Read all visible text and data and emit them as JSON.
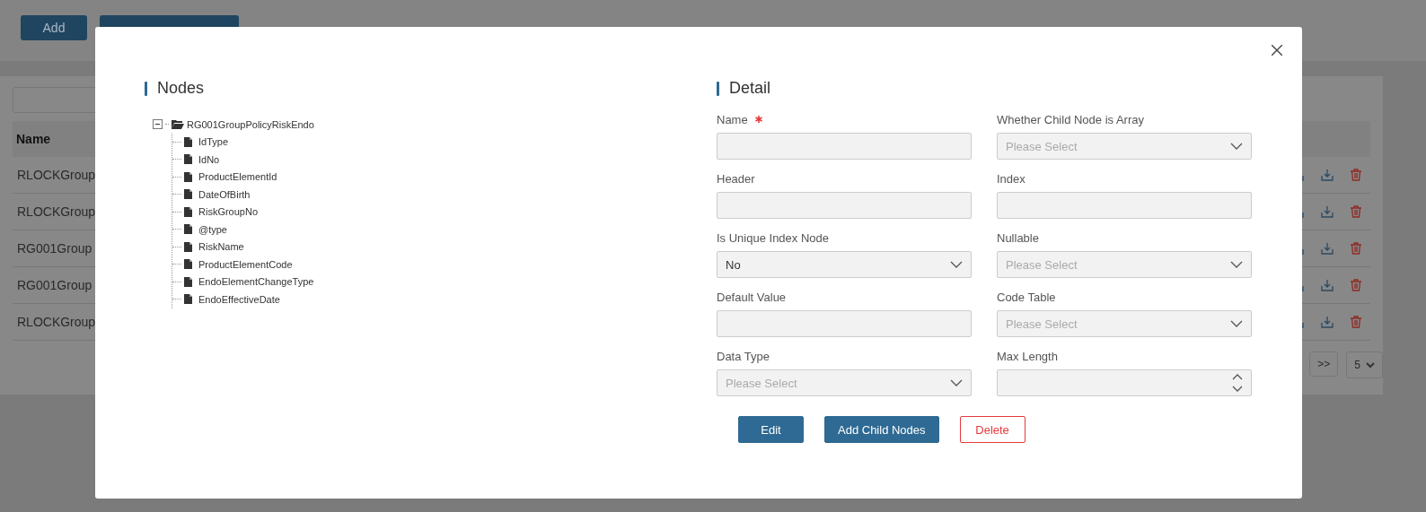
{
  "page": {
    "buttons": [
      {
        "label": "Add"
      }
    ],
    "table": {
      "columns": [
        "Name"
      ],
      "rows": [
        {
          "name": "RLOCKGroup"
        },
        {
          "name": "RLOCKGroup"
        },
        {
          "name": "RG001Group"
        },
        {
          "name": "RG001Group"
        },
        {
          "name": "RLOCKGroup"
        }
      ]
    },
    "pagination": {
      "next": ">>",
      "page_size": "5"
    }
  },
  "modal": {
    "nodes_title": "Nodes",
    "tree": {
      "label": "RG001GroupPolicyRiskEndo",
      "expanded": true,
      "children": [
        {
          "label": "IdType"
        },
        {
          "label": "IdNo"
        },
        {
          "label": "ProductElementId"
        },
        {
          "label": "DateOfBirth"
        },
        {
          "label": "RiskGroupNo"
        },
        {
          "label": "@type"
        },
        {
          "label": "RiskName"
        },
        {
          "label": "ProductElementCode"
        },
        {
          "label": "EndoElementChangeType"
        },
        {
          "label": "EndoEffectiveDate"
        }
      ]
    },
    "detail_title": "Detail",
    "fields": [
      {
        "label": "Name",
        "required": true,
        "kind": "input"
      },
      {
        "label": "Whether Child Node is Array",
        "required": false,
        "kind": "select",
        "placeholder": "Please Select"
      },
      {
        "label": "Header",
        "required": false,
        "kind": "input"
      },
      {
        "label": "Index",
        "required": false,
        "kind": "input"
      },
      {
        "label": "Is Unique Index Node",
        "required": false,
        "kind": "select",
        "value": "No"
      },
      {
        "label": "Nullable",
        "required": false,
        "kind": "select",
        "placeholder": "Please Select"
      },
      {
        "label": "Default Value",
        "required": false,
        "kind": "input"
      },
      {
        "label": "Code Table",
        "required": false,
        "kind": "select",
        "placeholder": "Please Select"
      },
      {
        "label": "Data Type",
        "required": false,
        "kind": "select",
        "placeholder": "Please Select"
      },
      {
        "label": "Max Length",
        "required": false,
        "kind": "number"
      }
    ],
    "buttons": [
      {
        "label": "Edit",
        "kind": "primary"
      },
      {
        "label": "Add Child Nodes",
        "kind": "primary"
      },
      {
        "label": "Delete",
        "kind": "danger"
      }
    ]
  }
}
